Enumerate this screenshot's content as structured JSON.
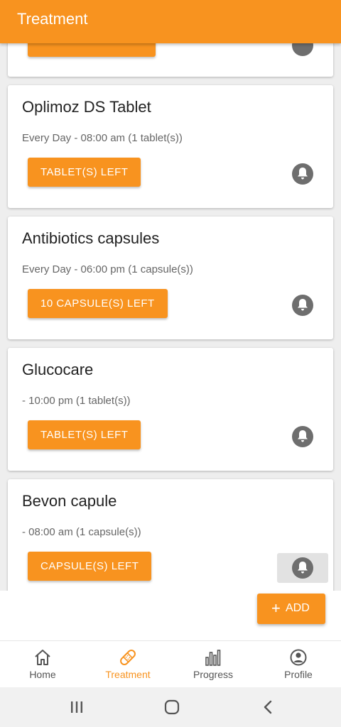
{
  "appbar": {
    "title": "Treatment"
  },
  "medications": [
    {
      "name": "Oplimoz DS Tablet",
      "schedule": "Every Day - 08:00 am (1 tablet(s))",
      "stock_label": "TABLET(S) LEFT",
      "reminder_icon": "bell-icon"
    },
    {
      "name": "Antibiotics capsules",
      "schedule": "Every Day - 06:00 pm (1 capsule(s))",
      "stock_label": "10 CAPSULE(S) LEFT",
      "reminder_icon": "bell-icon"
    },
    {
      "name": "Glucocare",
      "schedule": "- 10:00 pm (1 tablet(s))",
      "stock_label": "TABLET(S) LEFT",
      "reminder_icon": "bell-icon"
    },
    {
      "name": "Bevon capule",
      "schedule": "- 08:00 am (1 capsule(s))",
      "stock_label": "CAPSULE(S) LEFT",
      "reminder_icon": "bell-icon"
    }
  ],
  "fab": {
    "icon": "plus-icon",
    "label": "ADD"
  },
  "bottom_nav": [
    {
      "label": "Home",
      "icon": "home-icon",
      "active": false
    },
    {
      "label": "Treatment",
      "icon": "bandage-icon",
      "active": true
    },
    {
      "label": "Progress",
      "icon": "bar-chart-icon",
      "active": false
    },
    {
      "label": "Profile",
      "icon": "user-circle-icon",
      "active": false
    }
  ],
  "system_nav": [
    "recent-apps-icon",
    "home-circle-icon",
    "back-icon"
  ],
  "colors": {
    "accent": "#f8931f",
    "background": "#eeeeee",
    "icon_gray": "#6e6e6e"
  }
}
